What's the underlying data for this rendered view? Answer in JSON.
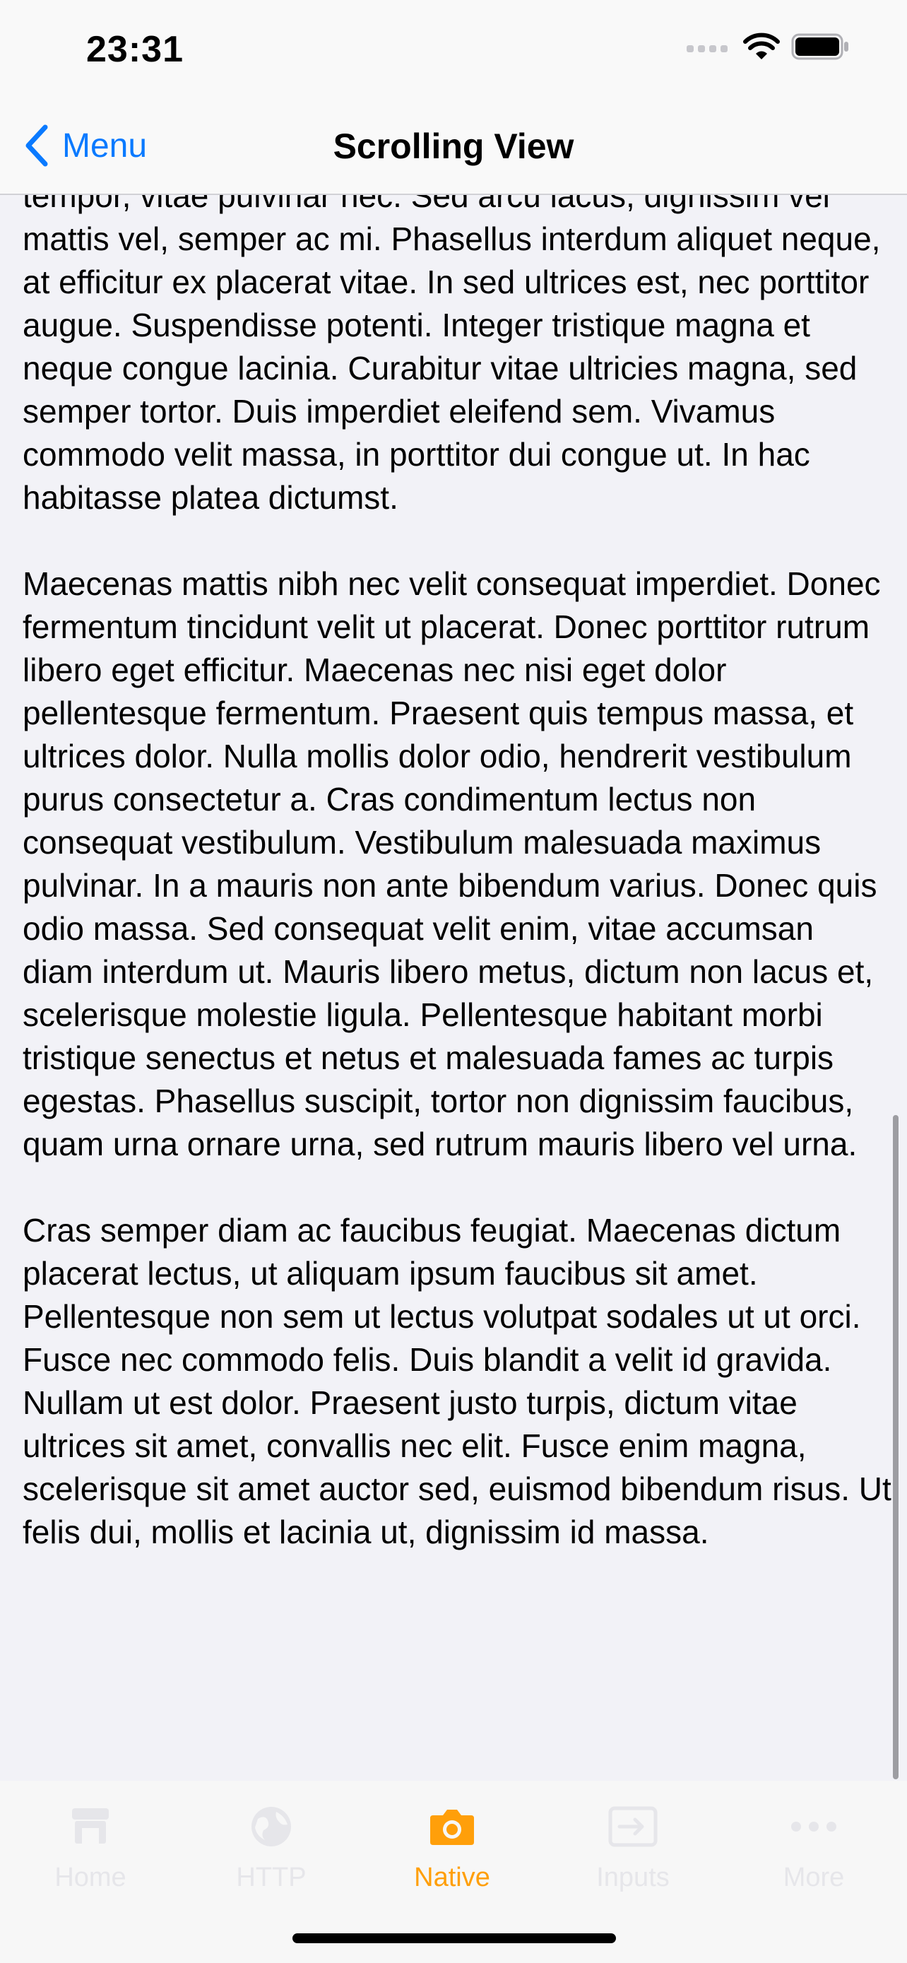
{
  "status_bar": {
    "time": "23:31"
  },
  "nav": {
    "back_label": "Menu",
    "title": "Scrolling View"
  },
  "content": {
    "paragraphs": [
      "Aliquam erat volutpat. Vestibulum posuere dolor at dui tempor, vitae pulvinar nec. Sed arcu lacus, dignissim vel mattis vel, semper ac mi. Phasellus interdum aliquet neque, at efficitur ex placerat vitae. In sed ultrices est, nec porttitor augue. Suspendisse potenti. Integer tristique magna et neque congue lacinia. Curabitur vitae ultricies magna, sed semper tortor. Duis imperdiet eleifend sem. Vivamus commodo velit massa, in porttitor dui congue ut. In hac habitasse platea dictumst.",
      "Maecenas mattis nibh nec velit consequat imperdiet. Donec fermentum tincidunt velit ut placerat. Donec porttitor rutrum libero eget efficitur. Maecenas nec nisi eget dolor pellentesque fermentum. Praesent quis tempus massa, et ultrices dolor. Nulla mollis dolor odio, hendrerit vestibulum purus consectetur a. Cras condimentum lectus non consequat vestibulum. Vestibulum malesuada maximus pulvinar. In a mauris non ante bibendum varius. Donec quis odio massa. Sed consequat velit enim, vitae accumsan diam interdum ut. Mauris libero metus, dictum non lacus et, scelerisque molestie ligula. Pellentesque habitant morbi tristique senectus et netus et malesuada fames ac turpis egestas. Phasellus suscipit, tortor non dignissim faucibus, quam urna ornare urna, sed rutrum mauris libero vel urna.",
      "Cras semper diam ac faucibus feugiat. Maecenas dictum placerat lectus, ut aliquam ipsum faucibus sit amet. Pellentesque non sem ut lectus volutpat sodales ut ut orci. Fusce nec commodo felis. Duis blandit a velit id gravida. Nullam ut est dolor. Praesent justo turpis, dictum vitae ultrices sit amet, convallis nec elit. Fusce enim magna, scelerisque sit amet auctor sed, euismod bibendum risus. Ut felis dui, mollis et lacinia ut, dignissim id massa."
    ]
  },
  "tabs": [
    {
      "label": "Home",
      "icon": "store-icon",
      "state": "disabled"
    },
    {
      "label": "HTTP",
      "icon": "globe-icon",
      "state": "disabled"
    },
    {
      "label": "Native",
      "icon": "camera-icon",
      "state": "active"
    },
    {
      "label": "Inputs",
      "icon": "input-icon",
      "state": "disabled"
    },
    {
      "label": "More",
      "icon": "more-icon",
      "state": "disabled"
    }
  ],
  "colors": {
    "accent": "#0a7aff",
    "active_tab": "#ff9f0a",
    "disabled_tab": "#e6e6ea"
  }
}
